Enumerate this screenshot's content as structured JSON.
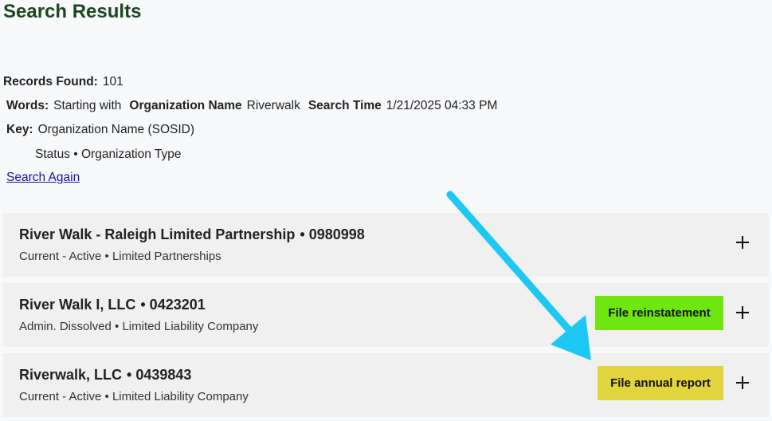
{
  "page": {
    "title": "Search Results"
  },
  "summary": {
    "records_found_label": "Records Found:",
    "records_found_value": "101",
    "words_label": "Words:",
    "words_value": "Starting with",
    "field_label": "Organization Name",
    "field_value": "Riverwalk",
    "time_label": "Search Time",
    "time_value": "1/21/2025 04:33 PM",
    "key_label": "Key:",
    "key_line1": "Organization Name (SOSID)",
    "key_line2": "Status • Organization Type",
    "search_again": "Search Again"
  },
  "results": [
    {
      "name": "River Walk - Raleigh Limited Partnership",
      "sosid": "• 0980998",
      "status_type": "Current - Active  •  Limited Partnerships",
      "action": ""
    },
    {
      "name": "River Walk I, LLC",
      "sosid": "• 0423201",
      "status_type": "Admin. Dissolved  •  Limited Liability Company",
      "action": "File reinstatement"
    },
    {
      "name": "Riverwalk, LLC",
      "sosid": "• 0439843",
      "status_type": "Current - Active  •  Limited Liability Company",
      "action": "File annual report"
    }
  ],
  "colors": {
    "title": "#1d4620",
    "reinstate_button": "#6ee60f",
    "annual_button": "#e2d43c",
    "arrow": "#1ec8f5"
  },
  "icons": {
    "expand": "plus-icon",
    "annotation": "arrow-annotation"
  }
}
